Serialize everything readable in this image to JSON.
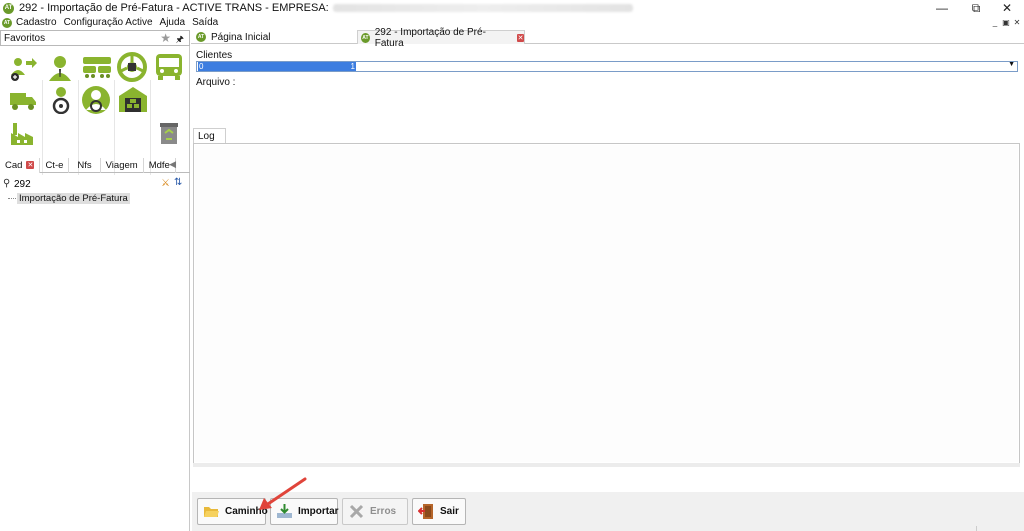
{
  "window": {
    "title": "292 - Importação de Pré-Fatura - ACTIVE TRANS - EMPRESA:",
    "logo_text": "AT",
    "controls": [
      "minimize",
      "restore",
      "close"
    ]
  },
  "menu": {
    "items": [
      "Cadastro",
      "Configuração Active",
      "Ajuda",
      "Saída"
    ]
  },
  "sidebar": {
    "favorites_label": "Favoritos",
    "icons": [
      "add-user-icon",
      "person-icon",
      "buses-icon",
      "steering-wheel-icon",
      "bus-front-icon",
      "truck-icon",
      "driver-icon",
      "driver-wheel-icon",
      "warehouse-icon",
      "factory-icon",
      "recycle-bin-icon"
    ],
    "tabs": [
      {
        "label": "Cad",
        "closable": true
      },
      {
        "label": "Ct-e"
      },
      {
        "label": "Nfs"
      },
      {
        "label": "Viagem"
      },
      {
        "label": "Mdfe"
      }
    ],
    "search_value": "292",
    "tree_item": "Importação de Pré-Fatura"
  },
  "doc_tabs": [
    {
      "label": "Página Inicial"
    },
    {
      "label": "292 - Importação de Pré-Fatura",
      "closable": true,
      "active": true
    }
  ],
  "form": {
    "clients_label": "Clientes",
    "clients_value": "0",
    "clients_value_end": "1",
    "file_label": "Arquivo :"
  },
  "log": {
    "tab_label": "Log"
  },
  "buttons": {
    "path": "Caminho",
    "import": "Importar",
    "errors": "Erros",
    "exit": "Sair"
  },
  "colors": {
    "brand_green": "#6a9a2a",
    "selection_blue": "#3c7de0",
    "close_red": "#d04a4a",
    "annotation_arrow": "#e0443a"
  }
}
